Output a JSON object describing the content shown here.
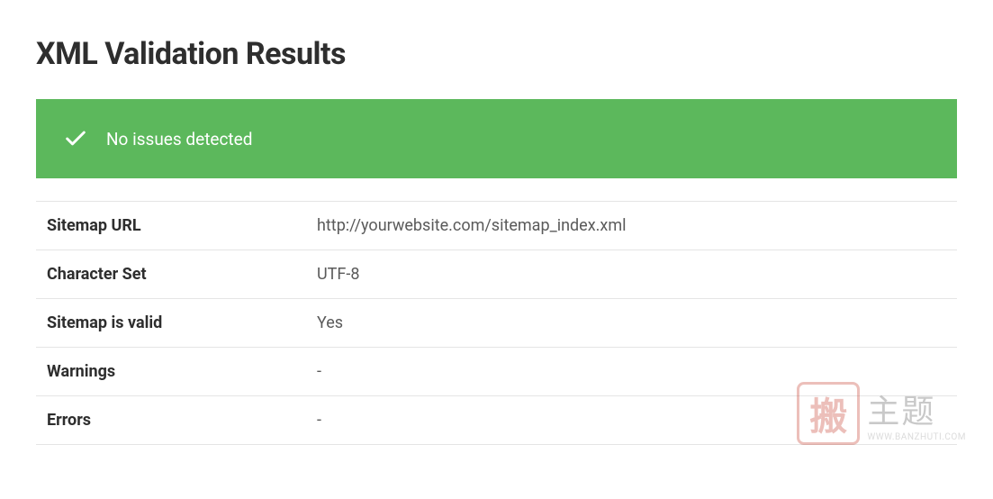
{
  "header": {
    "title": "XML Validation Results"
  },
  "status": {
    "message": "No issues detected",
    "success": true
  },
  "results": {
    "rows": [
      {
        "label": "Sitemap URL",
        "value": "http://yourwebsite.com/sitemap_index.xml"
      },
      {
        "label": "Character Set",
        "value": "UTF-8"
      },
      {
        "label": "Sitemap is valid",
        "value": "Yes"
      },
      {
        "label": "Warnings",
        "value": "-"
      },
      {
        "label": "Errors",
        "value": "-"
      }
    ]
  },
  "watermark": {
    "stamp_char": "搬",
    "text": "主题",
    "url": "WWW.BANZHUTI.COM"
  }
}
